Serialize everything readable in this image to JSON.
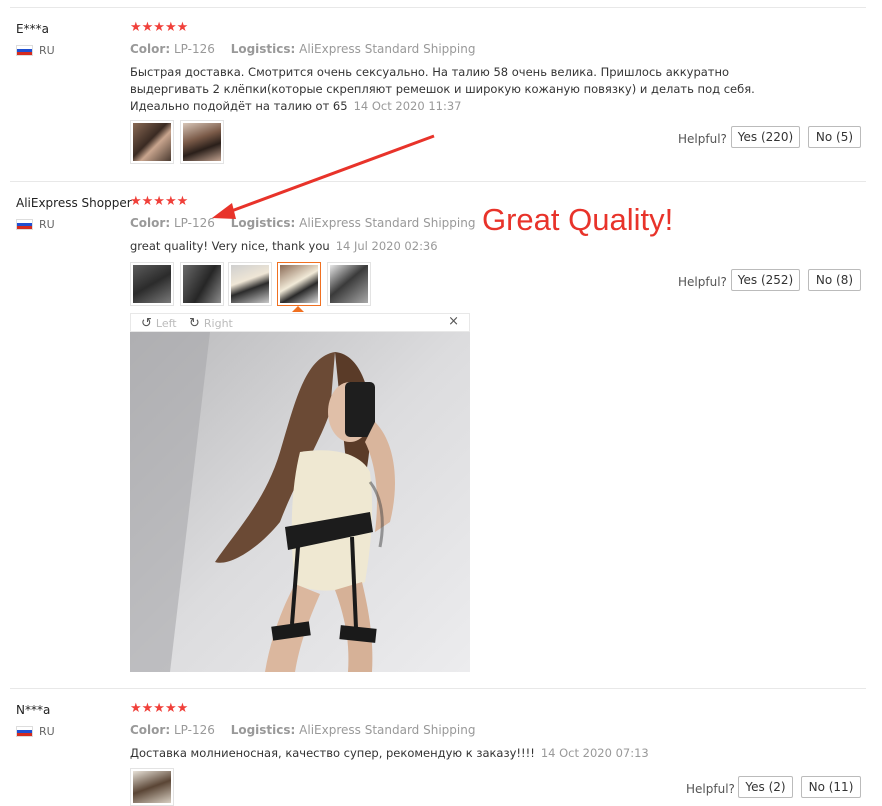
{
  "labels": {
    "color": "Color:",
    "logistics": "Logistics:",
    "helpful": "Helpful?",
    "rotate_left": "Left",
    "rotate_right": "Right",
    "close": "×"
  },
  "annotation": {
    "text": "Great Quality!",
    "color": "#e8332a"
  },
  "reviews": [
    {
      "name": "E***a",
      "country": "RU",
      "rating": 4.8,
      "stars": "★★★★★",
      "color": "LP-126",
      "logistics": "AliExpress Standard Shipping",
      "text": "Быстрая доставка. Смотрится очень сексуально. На талию 58 очень велика. Пришлось аккуратно выдергивать 2 клёпки(которые скрепляют ремешок и широкую кожаную повязку) и делать под себя. Идеально подойдёт на талию от 65",
      "date": "14 Oct 2020 11:37",
      "yes": "Yes (220)",
      "no": "No (5)"
    },
    {
      "name": "AliExpress Shopper",
      "country": "RU",
      "rating": 5,
      "stars": "★★★★★",
      "color": "LP-126",
      "logistics": "AliExpress Standard Shipping",
      "text": "great quality! Very nice, thank you",
      "date": "14 Jul 2020 02:36",
      "yes": "Yes (252)",
      "no": "No (8)"
    },
    {
      "name": "N***a",
      "country": "RU",
      "rating": 5,
      "stars": "★★★★★",
      "color": "LP-126",
      "logistics": "AliExpress Standard Shipping",
      "text": "Доставка молниеносная, качество супер, рекомендую к заказу!!!!",
      "date": "14 Oct 2020 07:13",
      "yes": "Yes (2)",
      "no": "No (11)"
    }
  ],
  "colors": {
    "star": "#f0403a",
    "accent": "#f07020",
    "muted": "#999999"
  }
}
